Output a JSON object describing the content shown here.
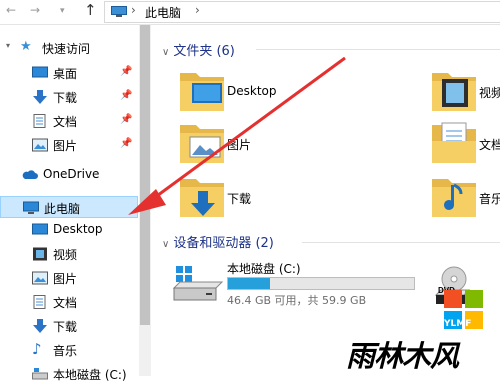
{
  "addressbar": {
    "back_icon": "back-arrow-icon",
    "forward_icon": "forward-arrow-icon",
    "dropdown_icon": "chevron-down-icon",
    "up_icon": "up-arrow-icon",
    "crumb": "此电脑"
  },
  "sidebar": {
    "quick_access": "快速访问",
    "quick_items": [
      {
        "label": "桌面",
        "icon": "desktop-icon"
      },
      {
        "label": "下载",
        "icon": "download-icon"
      },
      {
        "label": "文档",
        "icon": "documents-icon"
      },
      {
        "label": "图片",
        "icon": "pictures-icon"
      }
    ],
    "onedrive": "OneDrive",
    "this_pc": "此电脑",
    "pc_items": [
      {
        "label": "Desktop",
        "icon": "desktop-icon"
      },
      {
        "label": "视频",
        "icon": "videos-icon"
      },
      {
        "label": "图片",
        "icon": "pictures-icon"
      },
      {
        "label": "文档",
        "icon": "documents-icon"
      },
      {
        "label": "下载",
        "icon": "download-icon"
      },
      {
        "label": "音乐",
        "icon": "music-icon"
      },
      {
        "label": "本地磁盘 (C:)",
        "icon": "drive-icon"
      }
    ]
  },
  "content": {
    "folders_header": "文件夹 (6)",
    "folders": [
      {
        "label": "Desktop",
        "icon": "desktop-folder-icon"
      },
      {
        "label": "视频",
        "icon": "videos-folder-icon"
      },
      {
        "label": "图片",
        "icon": "pictures-folder-icon"
      },
      {
        "label": "文档",
        "icon": "documents-folder-icon"
      },
      {
        "label": "下载",
        "icon": "downloads-folder-icon"
      },
      {
        "label": "音乐",
        "icon": "music-folder-icon"
      }
    ],
    "devices_header": "设备和驱动器 (2)",
    "drive": {
      "name": "本地磁盘 (C:)",
      "free_text": "46.4 GB 可用，共 59.9 GB",
      "used_fraction": 0.225
    },
    "dvd_icon": "dvd-drive-icon",
    "dvd_label": "DVD"
  },
  "watermark": {
    "text": "雨林木风",
    "sub": "YLMF"
  },
  "colors": {
    "accent": "#26a0da",
    "selection": "#cce8ff",
    "arrow": "#e53030",
    "header_text": "#1e3287"
  }
}
